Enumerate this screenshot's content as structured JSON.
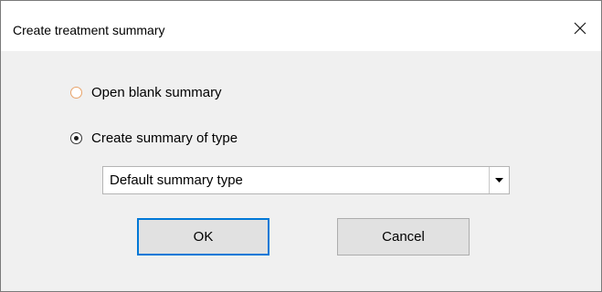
{
  "window": {
    "title": "Create treatment summary"
  },
  "options": [
    {
      "label": "Open blank summary",
      "selected": false
    },
    {
      "label": "Create summary of type",
      "selected": true
    }
  ],
  "summary_type_select": {
    "selected_value": "Default summary type"
  },
  "buttons": {
    "ok_label": "OK",
    "cancel_label": "Cancel"
  },
  "colors": {
    "dialog_background": "#f0f0f0",
    "titlebar_background": "#ffffff",
    "default_button_border": "#0078d7",
    "button_background": "#e1e1e1"
  }
}
